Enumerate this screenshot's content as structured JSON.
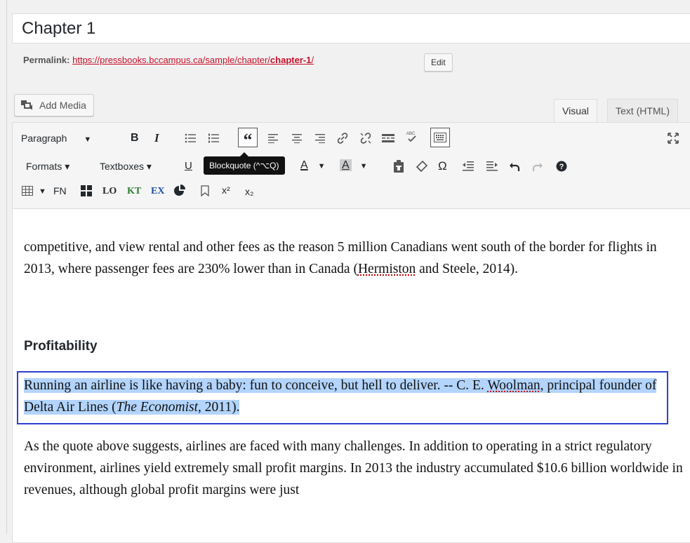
{
  "post": {
    "title": "Chapter 1"
  },
  "permalink": {
    "label": "Permalink:",
    "url_prefix": "https://pressbooks.bccampus.ca/sample/chapter/",
    "url_slug": "chapter-1",
    "url_suffix": "/",
    "edit_label": "Edit"
  },
  "media": {
    "add_media_label": "Add Media"
  },
  "tabs": {
    "visual": "Visual",
    "text": "Text (HTML)"
  },
  "toolbar": {
    "format_select": "Paragraph",
    "bold": "B",
    "italic": "I",
    "formats_label": "Formats ▾",
    "textboxes_label": "Textboxes ▾",
    "underline": "U",
    "tooltip": "Blockquote (^⌥Q)",
    "fn": "FN",
    "lo": "LO",
    "kt": "KT",
    "ex": "EX",
    "superscript": "x²",
    "subscript": "x₂",
    "omega": "Ω",
    "text_color": "A",
    "bg_color": "A"
  },
  "content": {
    "para1_part1": "competitive, and view rental and other fees as the reason 5 million Canadians went south of the border for flights in 2013, where passenger fees are 230% lower than in Canada (",
    "para1_spell": "Hermiston",
    "para1_part2": " and Steele, 2014).",
    "heading": "Profitability",
    "quote_part1": "Running an airline is like having a baby: fun to conceive, but hell to deliver. -- C. E. ",
    "quote_spell": "Woolman",
    "quote_part2": ", principal founder of Delta Air Lines (",
    "quote_italic": "The Economist",
    "quote_part3": ", 2011).",
    "para2": "As the quote above suggests, airlines are faced with many challenges. In addition to operating in a strict regulatory environment, airlines yield extremely small profit margins. In 2013 the industry accumulated $10.6 billion worldwide in revenues, although global profit margins were just"
  },
  "colors": {
    "link": "#c9102a",
    "selection": "#b3d4fc",
    "focus_border": "#2c3fd1",
    "kt_green": "#2e7d32",
    "ex_blue": "#1f4fa8"
  }
}
